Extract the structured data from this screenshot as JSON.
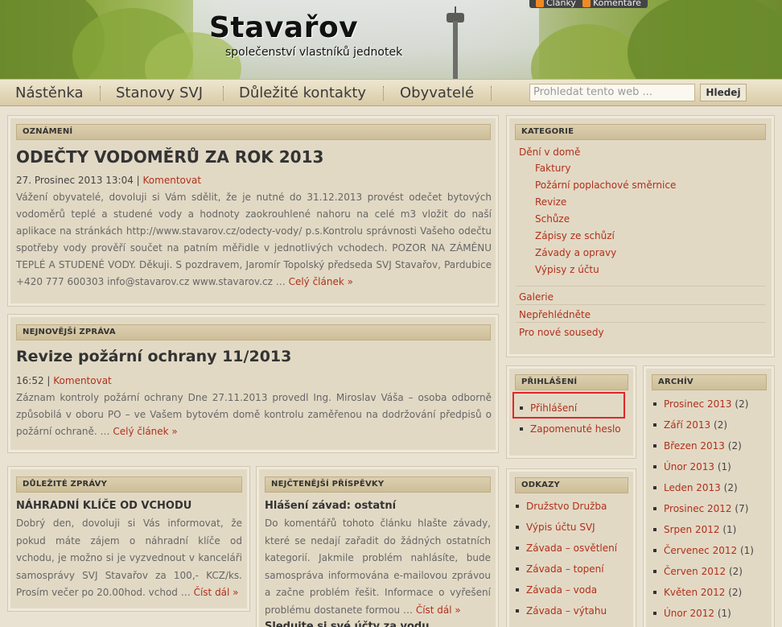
{
  "header": {
    "title": "Stavařov",
    "subtitle": "společenství vlastníků jednotek",
    "feeds": [
      "Články",
      "Komentáře"
    ]
  },
  "nav": {
    "items": [
      "Nástěnka",
      "Stanovy SVJ",
      "Důležité kontakty",
      "Obyvatelé"
    ],
    "search_placeholder": "Prohledat tento web ...",
    "search_button": "Hledej"
  },
  "announcement": {
    "section": "OZNÁMENÍ",
    "title": "ODEČTY VODOMĚRŮ ZA ROK 2013",
    "date": "27. Prosinec 2013 13:04",
    "sep": " | ",
    "comment": "Komentovat",
    "text": "Vážení obyvatelé, dovoluji si Vám sdělit, že je nutné do 31.12.2013 provést odečet bytových vodoměrů teplé a studené vody a hodnoty zaokrouhlené nahoru na celé m3 vložit do naší aplikace na stránkách http://www.stavarov.cz/odecty-vody/ p.s.Kontrolu správnosti Vašeho odečtu spotřeby vody prověří součet na patním měřidle v jednotlivých vchodech. POZOR NA ZÁMĚNU TEPLÉ A STUDENÉ VODY. Děkuji. S pozdravem, Jaromír Topolský předseda SVJ Stavařov, Pardubice +420 777 600303 info@stavarov.cz www.stavarov.cz",
    "ellipsis": " … ",
    "more": "Celý článek »"
  },
  "latest": {
    "section": "NEJNOVĚJŠÍ ZPRÁVA",
    "title": "Revize požární ochrany 11/2013",
    "date": "16:52",
    "sep": " | ",
    "comment": "Komentovat",
    "text": "Záznam kontroly požární ochrany Dne 27.11.2013 provedl Ing. Miroslav Váša – osoba odborně způsobilá v oboru PO – ve Vašem bytovém domě kontrolu zaměřenou na dodržování předpisů o požární ochraně.",
    "ellipsis": " … ",
    "more": "Celý článek »"
  },
  "important": {
    "section": "DŮLEŽITÉ ZPRÁVY",
    "title": "NÁHRADNÍ KLÍČE OD VCHODU",
    "text": "Dobrý den, dovoluji si Vás informovat, že pokud máte zájem o náhradní klíče od vchodu, je možno si je vyzvednout v kanceláři samosprávy SVJ Stavařov za 100,- KCZ/ks. Prosím večer po 20.00hod. vchod",
    "ellipsis": " … ",
    "more": "Číst dál »"
  },
  "most_read": {
    "section": "NEJČTENĚJŠÍ PŘÍSPĚVKY",
    "title": "Hlášení závad: ostatní",
    "text": "Do komentářů tohoto článku hlašte závady, které se nedají zařadit do žádných ostatních kategorií. Jakmile problém nahlásíte, bude samospráva informována e-mailovou zprávou a začne problém řešit. Informace o vyřešení problému dostanete formou",
    "ellipsis": " … ",
    "more": "Číst dál »",
    "next_title": "Sledujte si své účty za vodu"
  },
  "categories": {
    "section": "KATEGORIE",
    "parent": "Dění v domě",
    "children": [
      "Faktury",
      "Požární poplachové směrnice",
      "Revize",
      "Schůze",
      "Zápisy ze schůzí",
      "Závady a opravy",
      "Výpisy z účtu"
    ],
    "others": [
      "Galerie",
      "Nepřehlédněte",
      "Pro nové sousedy"
    ]
  },
  "login": {
    "section": "PŘIHLÁŠENÍ",
    "items": [
      "Přihlášení",
      "Zapomenuté heslo"
    ]
  },
  "links": {
    "section": "ODKAZY",
    "items": [
      "Družstvo Družba",
      "Výpis účtu SVJ",
      "Závada – osvětlení",
      "Závada – topení",
      "Závada – voda",
      "Závada – výtahu"
    ]
  },
  "archive": {
    "section": "ARCHÍV",
    "items": [
      {
        "month": "Prosinec 2013",
        "count": "(2)"
      },
      {
        "month": "Září 2013",
        "count": "(2)"
      },
      {
        "month": "Březen 2013",
        "count": "(2)"
      },
      {
        "month": "Únor 2013",
        "count": "(1)"
      },
      {
        "month": "Leden 2013",
        "count": "(2)"
      },
      {
        "month": "Prosinec 2012",
        "count": "(7)"
      },
      {
        "month": "Srpen 2012",
        "count": "(1)"
      },
      {
        "month": "Červenec 2012",
        "count": "(1)"
      },
      {
        "month": "Červen 2012",
        "count": "(2)"
      },
      {
        "month": "Květen 2012",
        "count": "(2)"
      },
      {
        "month": "Únor 2012",
        "count": "(1)"
      }
    ]
  }
}
